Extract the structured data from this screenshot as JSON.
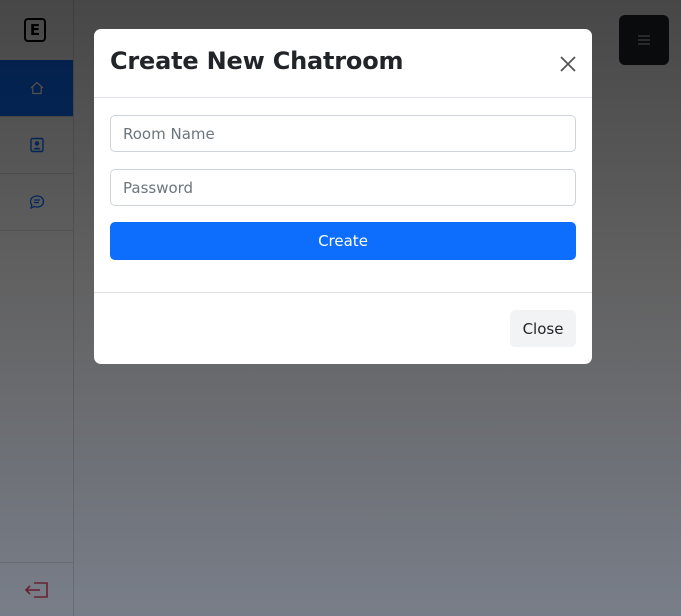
{
  "sidebar": {
    "logo_letter": "E",
    "items": [
      {
        "icon": "house-icon",
        "active": true
      },
      {
        "icon": "person-badge-icon",
        "active": false
      },
      {
        "icon": "chat-icon",
        "active": false
      }
    ],
    "logout_icon": "logout-icon",
    "logout_color": "#dc3545"
  },
  "header": {
    "menu_icon": "hamburger-menu-icon"
  },
  "modal": {
    "title": "Create New Chatroom",
    "room_name_placeholder": "Room Name",
    "room_name_value": "",
    "password_placeholder": "Password",
    "password_value": "",
    "create_label": "Create",
    "close_label": "Close"
  },
  "colors": {
    "accent": "#0d6efd",
    "dark": "#212529"
  }
}
